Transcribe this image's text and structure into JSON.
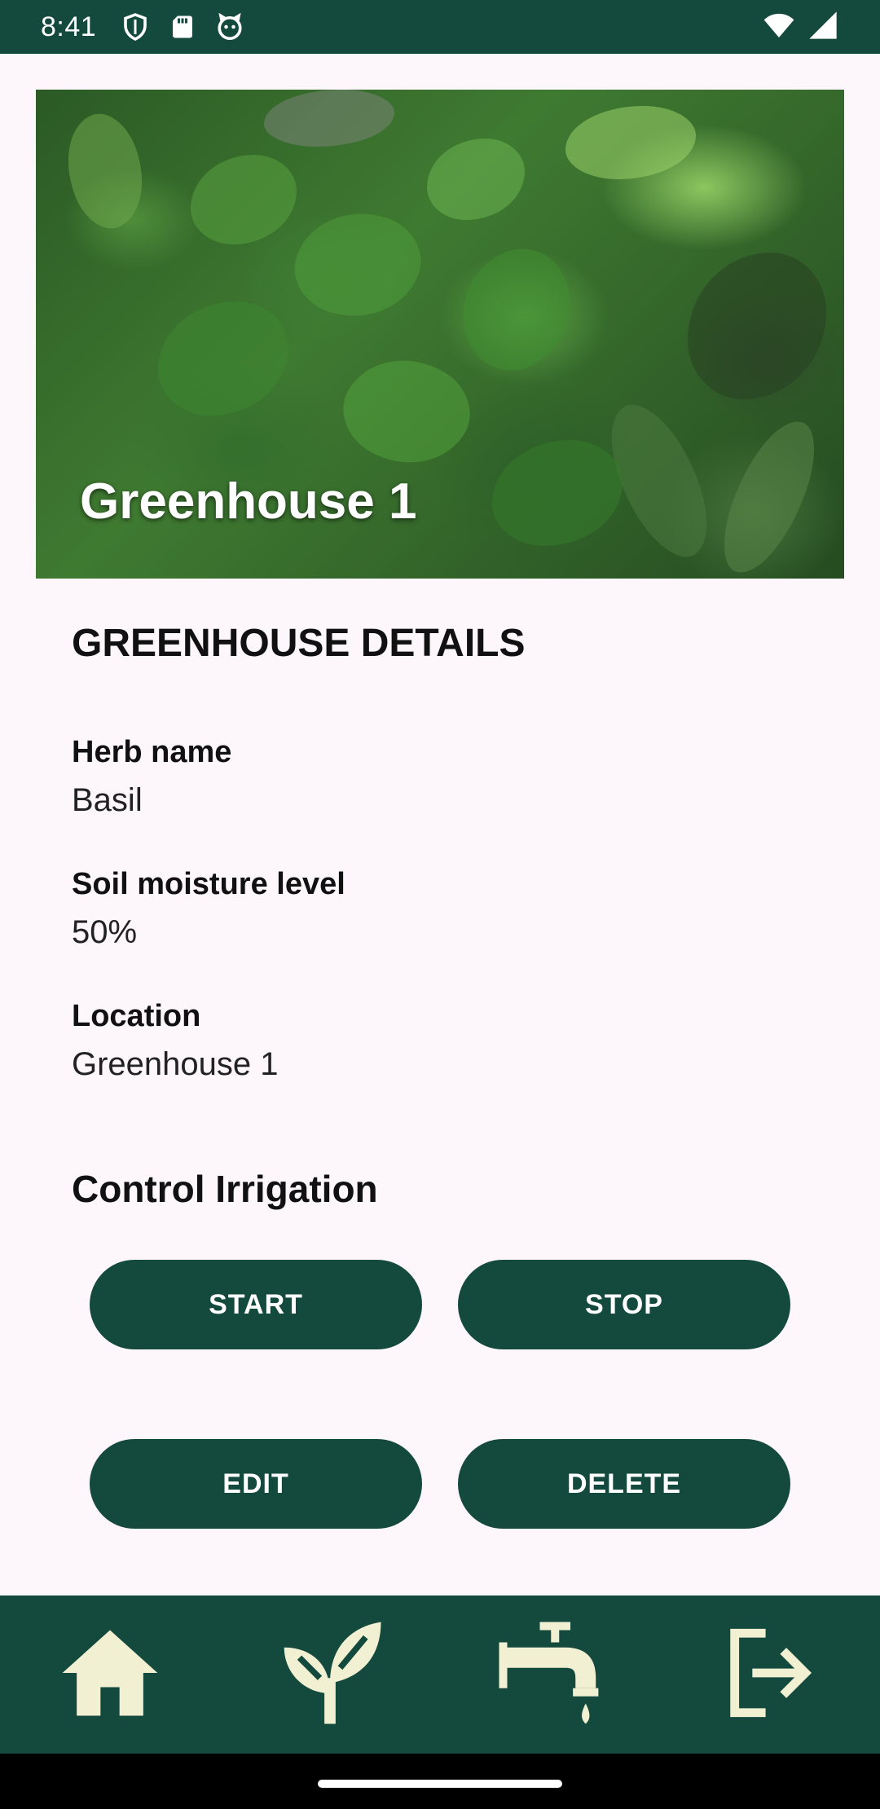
{
  "status_bar": {
    "time": "8:41",
    "icons": [
      "shield-icon",
      "sd-card-icon",
      "cat-icon",
      "wifi-icon",
      "signal-icon"
    ]
  },
  "hero": {
    "title": "Greenhouse 1"
  },
  "details": {
    "section_title": "GREENHOUSE DETAILS",
    "herb_label": "Herb name",
    "herb_value": "Basil",
    "moisture_label": "Soil moisture level",
    "moisture_value": "50%",
    "location_label": "Location",
    "location_value": "Greenhouse 1"
  },
  "irrigation": {
    "title": "Control Irrigation",
    "start_label": "START",
    "stop_label": "STOP"
  },
  "actions": {
    "edit_label": "EDIT",
    "delete_label": "DELETE"
  },
  "bottom_nav": {
    "items": [
      "home-icon",
      "plant-icon",
      "faucet-icon",
      "logout-icon"
    ]
  },
  "colors": {
    "primary": "#14493d",
    "icon": "#f1f0d2",
    "background": "#fdf6fb"
  }
}
